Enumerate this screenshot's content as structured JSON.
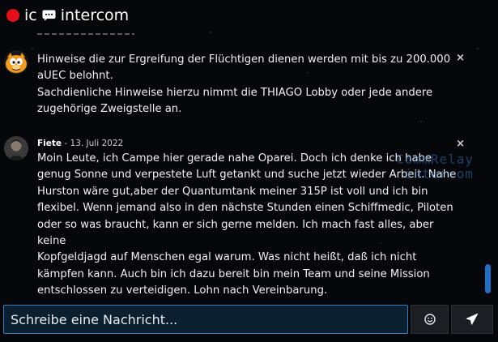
{
  "header": {
    "brand_prefix": "ic",
    "brand_name": "intercom",
    "dot_color": "#e3101a"
  },
  "messages": [
    {
      "avatar": "garfield-avatar",
      "lines": [
        "Hinweise die zur Ergreifung der Flüchtigen dienen werden mit bis zu 200.000",
        "aUEC belohnt.",
        "Sachdienliche Hinweise hierzu nimmt die THIAGO Lobby oder jede andere",
        "zugehörige Zweigstelle an."
      ],
      "close_label": "×"
    },
    {
      "avatar": "dark-portrait-avatar",
      "author": "Fiete",
      "date": " - 13. Juli 2022",
      "lines": [
        "Moin Leute, ich Campe hier gerade nahe Oparei. Doch ich denke ich habe",
        "genug Sonne und verpestete Luft getankt und suche jetzt wieder Arbeit. Nahe",
        "Hurston wäre gut,aber der Quantumtank meiner 315P ist voll und ich bin",
        "flexibel. Wenn jemand also in den nächste Stunden einen Schiffmedic, Piloten",
        "oder so was braucht, kann er sich gerne melden. Ich mach fast alles, aber keine",
        "Kopfgeldjagd auf Menschen egal warum. Was nicht heißt, daß ich nicht",
        "kämpfen kann. Auch bin ich dazu bereit bin mein Team und seine Mission",
        "entschlossen zu verteidigen. Lohn nach Vereinbarung."
      ],
      "close_label": "×"
    }
  ],
  "watermark": {
    "line1": "CommRelay",
    "line2": "intercom"
  },
  "composer": {
    "placeholder": "Schreibe eine Nachricht...",
    "emoji_icon": "emoji-icon",
    "send_icon": "paper-plane-icon"
  },
  "colors": {
    "accent": "#1f6fc4",
    "input_border": "#3a7bc8"
  }
}
